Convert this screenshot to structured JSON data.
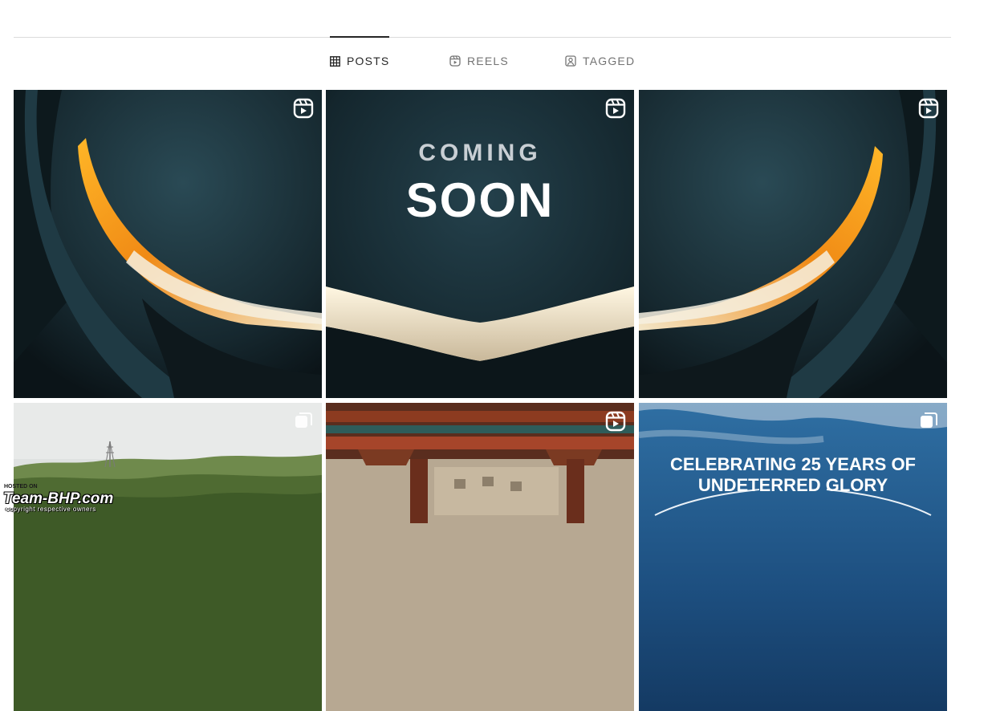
{
  "profile_tabs": {
    "posts": {
      "label": "POSTS",
      "icon": "grid-icon",
      "active": true
    },
    "reels": {
      "label": "REELS",
      "icon": "reels-icon",
      "active": false
    },
    "tagged": {
      "label": "TAGGED",
      "icon": "tagged-user-icon",
      "active": false
    }
  },
  "posts": [
    {
      "badge": "reel-icon"
    },
    {
      "badge": "reel-icon",
      "caption_line1": "COMING",
      "caption_line2": "SOON"
    },
    {
      "badge": "reel-icon"
    },
    {
      "badge": "carousel-icon"
    },
    {
      "badge": "reel-icon"
    },
    {
      "badge": "carousel-icon",
      "caption_line1": "CELEBRATING 25 YEARS OF",
      "caption_line2": "UNDETERRED GLORY"
    }
  ],
  "watermark": {
    "hosted": "HOSTED ON",
    "brand": "Team-BHP.com",
    "copyright": "copyright respective owners"
  },
  "colors": {
    "active_tab": "#262626",
    "inactive_tab": "#737373",
    "divider": "#dbdbdb",
    "headlight_amber": "#f5a623",
    "scooter_teal": "#1d3640"
  }
}
